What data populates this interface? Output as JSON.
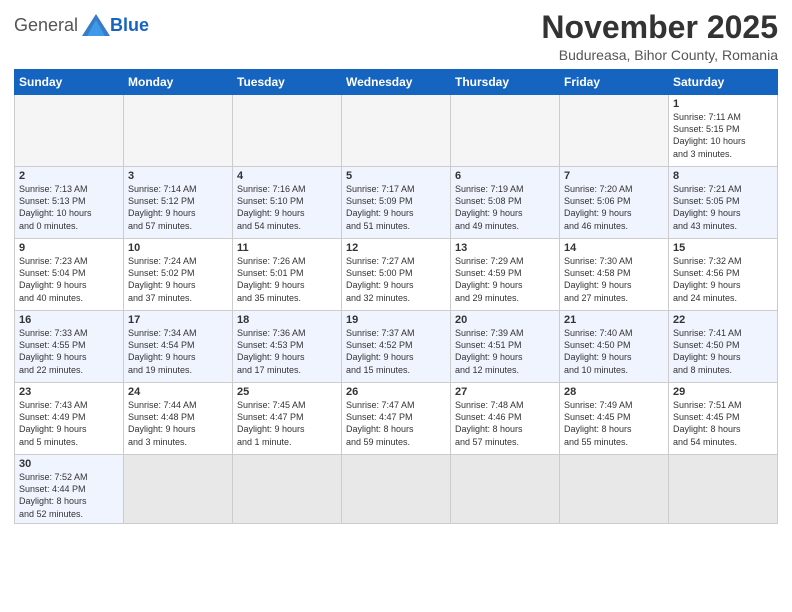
{
  "logo": {
    "general": "General",
    "blue": "Blue"
  },
  "header": {
    "month_year": "November 2025",
    "location": "Budureasa, Bihor County, Romania"
  },
  "weekdays": [
    "Sunday",
    "Monday",
    "Tuesday",
    "Wednesday",
    "Thursday",
    "Friday",
    "Saturday"
  ],
  "weeks": [
    [
      {
        "day": "",
        "info": ""
      },
      {
        "day": "",
        "info": ""
      },
      {
        "day": "",
        "info": ""
      },
      {
        "day": "",
        "info": ""
      },
      {
        "day": "",
        "info": ""
      },
      {
        "day": "",
        "info": ""
      },
      {
        "day": "1",
        "info": "Sunrise: 7:11 AM\nSunset: 5:15 PM\nDaylight: 10 hours\nand 3 minutes."
      }
    ],
    [
      {
        "day": "2",
        "info": "Sunrise: 7:13 AM\nSunset: 5:13 PM\nDaylight: 10 hours\nand 0 minutes."
      },
      {
        "day": "3",
        "info": "Sunrise: 7:14 AM\nSunset: 5:12 PM\nDaylight: 9 hours\nand 57 minutes."
      },
      {
        "day": "4",
        "info": "Sunrise: 7:16 AM\nSunset: 5:10 PM\nDaylight: 9 hours\nand 54 minutes."
      },
      {
        "day": "5",
        "info": "Sunrise: 7:17 AM\nSunset: 5:09 PM\nDaylight: 9 hours\nand 51 minutes."
      },
      {
        "day": "6",
        "info": "Sunrise: 7:19 AM\nSunset: 5:08 PM\nDaylight: 9 hours\nand 49 minutes."
      },
      {
        "day": "7",
        "info": "Sunrise: 7:20 AM\nSunset: 5:06 PM\nDaylight: 9 hours\nand 46 minutes."
      },
      {
        "day": "8",
        "info": "Sunrise: 7:21 AM\nSunset: 5:05 PM\nDaylight: 9 hours\nand 43 minutes."
      }
    ],
    [
      {
        "day": "9",
        "info": "Sunrise: 7:23 AM\nSunset: 5:04 PM\nDaylight: 9 hours\nand 40 minutes."
      },
      {
        "day": "10",
        "info": "Sunrise: 7:24 AM\nSunset: 5:02 PM\nDaylight: 9 hours\nand 37 minutes."
      },
      {
        "day": "11",
        "info": "Sunrise: 7:26 AM\nSunset: 5:01 PM\nDaylight: 9 hours\nand 35 minutes."
      },
      {
        "day": "12",
        "info": "Sunrise: 7:27 AM\nSunset: 5:00 PM\nDaylight: 9 hours\nand 32 minutes."
      },
      {
        "day": "13",
        "info": "Sunrise: 7:29 AM\nSunset: 4:59 PM\nDaylight: 9 hours\nand 29 minutes."
      },
      {
        "day": "14",
        "info": "Sunrise: 7:30 AM\nSunset: 4:58 PM\nDaylight: 9 hours\nand 27 minutes."
      },
      {
        "day": "15",
        "info": "Sunrise: 7:32 AM\nSunset: 4:56 PM\nDaylight: 9 hours\nand 24 minutes."
      }
    ],
    [
      {
        "day": "16",
        "info": "Sunrise: 7:33 AM\nSunset: 4:55 PM\nDaylight: 9 hours\nand 22 minutes."
      },
      {
        "day": "17",
        "info": "Sunrise: 7:34 AM\nSunset: 4:54 PM\nDaylight: 9 hours\nand 19 minutes."
      },
      {
        "day": "18",
        "info": "Sunrise: 7:36 AM\nSunset: 4:53 PM\nDaylight: 9 hours\nand 17 minutes."
      },
      {
        "day": "19",
        "info": "Sunrise: 7:37 AM\nSunset: 4:52 PM\nDaylight: 9 hours\nand 15 minutes."
      },
      {
        "day": "20",
        "info": "Sunrise: 7:39 AM\nSunset: 4:51 PM\nDaylight: 9 hours\nand 12 minutes."
      },
      {
        "day": "21",
        "info": "Sunrise: 7:40 AM\nSunset: 4:50 PM\nDaylight: 9 hours\nand 10 minutes."
      },
      {
        "day": "22",
        "info": "Sunrise: 7:41 AM\nSunset: 4:50 PM\nDaylight: 9 hours\nand 8 minutes."
      }
    ],
    [
      {
        "day": "23",
        "info": "Sunrise: 7:43 AM\nSunset: 4:49 PM\nDaylight: 9 hours\nand 5 minutes."
      },
      {
        "day": "24",
        "info": "Sunrise: 7:44 AM\nSunset: 4:48 PM\nDaylight: 9 hours\nand 3 minutes."
      },
      {
        "day": "25",
        "info": "Sunrise: 7:45 AM\nSunset: 4:47 PM\nDaylight: 9 hours\nand 1 minute."
      },
      {
        "day": "26",
        "info": "Sunrise: 7:47 AM\nSunset: 4:47 PM\nDaylight: 8 hours\nand 59 minutes."
      },
      {
        "day": "27",
        "info": "Sunrise: 7:48 AM\nSunset: 4:46 PM\nDaylight: 8 hours\nand 57 minutes."
      },
      {
        "day": "28",
        "info": "Sunrise: 7:49 AM\nSunset: 4:45 PM\nDaylight: 8 hours\nand 55 minutes."
      },
      {
        "day": "29",
        "info": "Sunrise: 7:51 AM\nSunset: 4:45 PM\nDaylight: 8 hours\nand 54 minutes."
      }
    ],
    [
      {
        "day": "30",
        "info": "Sunrise: 7:52 AM\nSunset: 4:44 PM\nDaylight: 8 hours\nand 52 minutes."
      },
      {
        "day": "",
        "info": ""
      },
      {
        "day": "",
        "info": ""
      },
      {
        "day": "",
        "info": ""
      },
      {
        "day": "",
        "info": ""
      },
      {
        "day": "",
        "info": ""
      },
      {
        "day": "",
        "info": ""
      }
    ]
  ]
}
